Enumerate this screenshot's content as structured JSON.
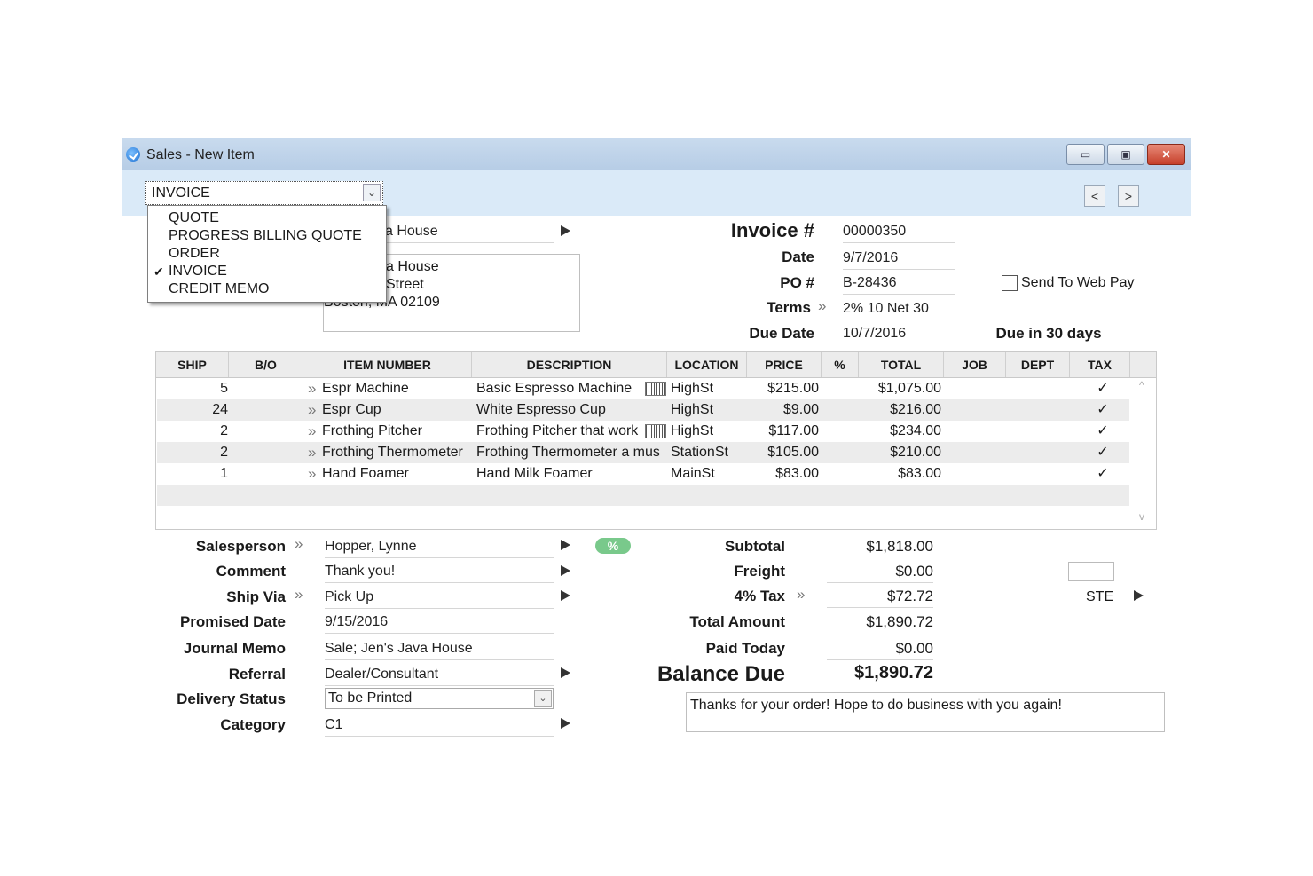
{
  "window": {
    "title": "Sales - New Item",
    "minimize": "▭",
    "maximize": "▣",
    "close": "✕"
  },
  "toolbar": {
    "doc_type": "INVOICE",
    "select_arrow": "⌄",
    "prev": "<",
    "next": ">"
  },
  "doctype_menu": {
    "items": [
      {
        "label": "QUOTE",
        "checked": false
      },
      {
        "label": "PROGRESS BILLING QUOTE",
        "checked": false
      },
      {
        "label": "ORDER",
        "checked": false
      },
      {
        "label": "INVOICE",
        "checked": true
      },
      {
        "label": "CREDIT MEMO",
        "checked": false
      }
    ],
    "check_mark": "✔"
  },
  "customer": {
    "name_partial": "a House",
    "address_line1": "a House",
    "address_line2": "Street",
    "address_line3": "Boston, MA 02109"
  },
  "header": {
    "invoice_label": "Invoice #",
    "invoice_value": "00000350",
    "date_label": "Date",
    "date_value": "9/7/2016",
    "po_label": "PO #",
    "po_value": "B-28436",
    "terms_label": "Terms",
    "terms_value": "2% 10 Net 30",
    "due_date_label": "Due Date",
    "due_date_value": "10/7/2016",
    "due_in": "Due in 30 days",
    "send_web_pay": "Send To Web Pay",
    "chevron": "»"
  },
  "grid": {
    "columns": [
      "SHIP",
      "B/O",
      "ITEM NUMBER",
      "DESCRIPTION",
      "LOCATION",
      "PRICE",
      "%",
      "TOTAL",
      "JOB",
      "DEPT",
      "TAX"
    ],
    "rows": [
      {
        "ship": "5",
        "item": "Espr Machine",
        "description": "Basic Espresso Machine",
        "location": "HighSt",
        "price": "$215.00",
        "total": "$1,075.00",
        "tax": "✓"
      },
      {
        "ship": "24",
        "item": "Espr Cup",
        "description": "White Espresso Cup",
        "location": "HighSt",
        "price": "$9.00",
        "total": "$216.00",
        "tax": "✓"
      },
      {
        "ship": "2",
        "item": "Frothing Pitcher",
        "description": "Frothing Pitcher that work",
        "location": "HighSt",
        "price": "$117.00",
        "total": "$234.00",
        "tax": "✓"
      },
      {
        "ship": "2",
        "item": "Frothing Thermometer",
        "description": "Frothing Thermometer a mus",
        "location": "StationSt",
        "price": "$105.00",
        "total": "$210.00",
        "tax": "✓"
      },
      {
        "ship": "1",
        "item": "Hand Foamer",
        "description": "Hand Milk Foamer",
        "location": "MainSt",
        "price": "$83.00",
        "total": "$83.00",
        "tax": "✓"
      }
    ],
    "scroll_up": "^",
    "scroll_down": "v"
  },
  "footer": {
    "salesperson_label": "Salesperson",
    "salesperson_value": "Hopper, Lynne",
    "comment_label": "Comment",
    "comment_value": "Thank you!",
    "ship_via_label": "Ship Via",
    "ship_via_value": "Pick Up",
    "promised_date_label": "Promised Date",
    "promised_date_value": "9/15/2016",
    "journal_memo_label": "Journal Memo",
    "journal_memo_value": "Sale; Jen's Java House",
    "referral_label": "Referral",
    "referral_value": "Dealer/Consultant",
    "delivery_status_label": "Delivery Status",
    "delivery_status_value": "To be Printed",
    "category_label": "Category",
    "category_value": "C1",
    "pct_badge": "%"
  },
  "totals": {
    "subtotal_label": "Subtotal",
    "subtotal_value": "$1,818.00",
    "freight_label": "Freight",
    "freight_value": "$0.00",
    "tax_label": "4% Tax",
    "tax_value": "$72.72",
    "total_label": "Total Amount",
    "total_value": "$1,890.72",
    "paid_label": "Paid Today",
    "paid_value": "$0.00",
    "balance_label": "Balance Due",
    "balance_value": "$1,890.72",
    "tax_code": "STE",
    "memo": "Thanks for your order! Hope to do business with you again!"
  }
}
